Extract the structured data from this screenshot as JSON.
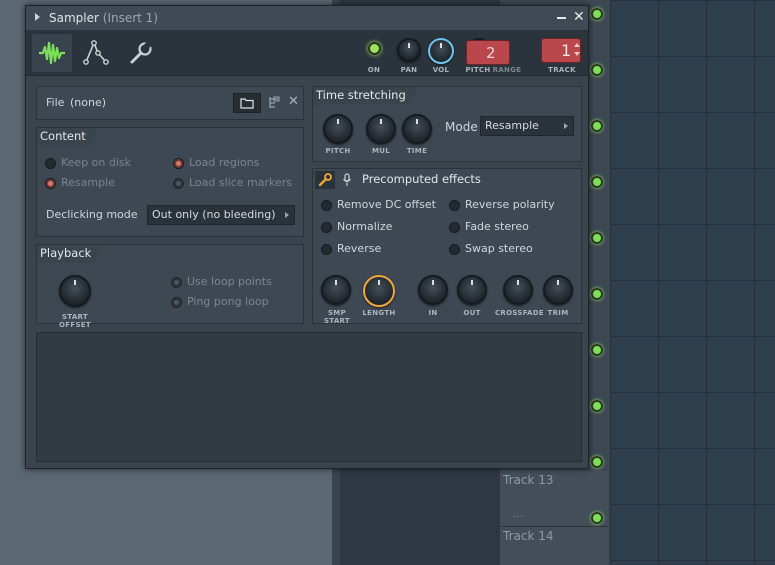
{
  "window": {
    "title": "Sampler",
    "subtitle": "(Insert 1)"
  },
  "toolbar": {
    "labels": {
      "on": "ON",
      "pan": "PAN",
      "vol": "VOL",
      "pitch": "PITCH",
      "range": "RANGE",
      "track": "TRACK"
    },
    "range_value": "2",
    "track_value": "1",
    "icons": [
      "waveform-icon",
      "envelope-icon",
      "wrench-icon"
    ]
  },
  "file": {
    "label": "File",
    "value": "(none)"
  },
  "content": {
    "title": "Content",
    "options": {
      "keep_on_disk": "Keep on disk",
      "resample": "Resample",
      "load_regions": "Load regions",
      "load_slice_markers": "Load slice markers"
    },
    "declicking_label": "Declicking mode",
    "declicking_value": "Out only (no bleeding)"
  },
  "playback": {
    "title": "Playback",
    "start_offset": "START OFFSET",
    "use_loop_points": "Use loop points",
    "ping_pong_loop": "Ping pong loop"
  },
  "time_stretching": {
    "title": "Time stretching",
    "knobs": {
      "pitch": "PITCH",
      "mul": "MUL",
      "time": "TIME"
    },
    "mode_label": "Mode",
    "mode_value": "Resample"
  },
  "precomputed": {
    "title": "Precomputed effects",
    "options": {
      "remove_dc": "Remove DC offset",
      "normalize": "Normalize",
      "reverse": "Reverse",
      "reverse_polarity": "Reverse polarity",
      "fade_stereo": "Fade stereo",
      "swap_stereo": "Swap stereo"
    },
    "knobs": {
      "smp_start": "SMP START",
      "length": "LENGTH",
      "in": "IN",
      "out": "OUT",
      "crossfade": "CROSSFADE",
      "trim": "TRIM"
    }
  },
  "tracks": [
    {
      "name": "Track 13",
      "dots": "..."
    },
    {
      "name": "Track 14",
      "dots": ""
    }
  ],
  "colors": {
    "accent": "#7ee05a",
    "vol_knob": "#6ec3ea",
    "length_knob": "#f0a63a",
    "track_box": "#b9474c"
  }
}
